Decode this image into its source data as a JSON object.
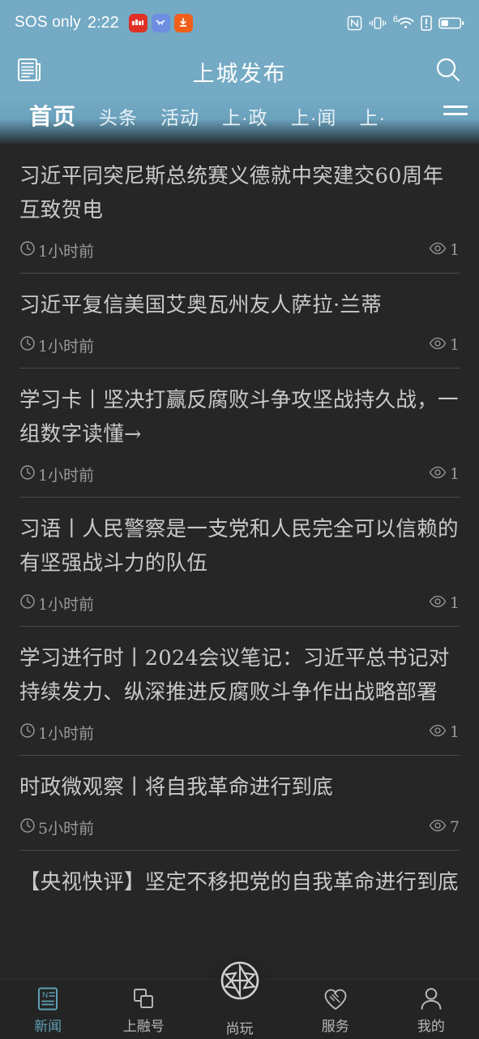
{
  "statusbar": {
    "carrier": "SOS only",
    "time": "2:22",
    "app_icons": [
      {
        "name": "red-app-icon",
        "color": "#e03127"
      },
      {
        "name": "blue-app-icon",
        "color": "#6d8ee0"
      },
      {
        "name": "download-icon",
        "color": "#f1601a"
      }
    ],
    "right_icons": [
      "nfc-icon",
      "vibrate-icon",
      "wifi-6-icon",
      "sim-alert-icon",
      "battery-icon"
    ],
    "wifi_generation": "6",
    "background_color": "#74aac4"
  },
  "header": {
    "title": "上城发布",
    "left_icon": "newspaper-icon",
    "right_icon": "search-icon",
    "background_color": "#74aac4"
  },
  "tabs": {
    "items": [
      {
        "label": "首页",
        "active": true
      },
      {
        "label": "头条",
        "active": false
      },
      {
        "label": "活动",
        "active": false
      },
      {
        "label": "上·政",
        "active": false
      },
      {
        "label": "上·闻",
        "active": false
      },
      {
        "label": "上·",
        "active": false
      }
    ],
    "menu_icon": "hamburger-menu-icon"
  },
  "articles": [
    {
      "title": "习近平同突尼斯总统赛义德就中突建交60周年互致贺电",
      "time": "1小时前",
      "views": "1"
    },
    {
      "title": "习近平复信美国艾奥瓦州友人萨拉·兰蒂",
      "time": "1小时前",
      "views": "1"
    },
    {
      "title": "学习卡丨坚决打赢反腐败斗争攻坚战持久战，一组数字读懂→",
      "time": "1小时前",
      "views": "1"
    },
    {
      "title": "习语丨人民警察是一支党和人民完全可以信赖的有坚强战斗力的队伍",
      "time": "1小时前",
      "views": "1"
    },
    {
      "title": "学习进行时丨2024会议笔记：习近平总书记对持续发力、纵深推进反腐败斗争作出战略部署",
      "time": "1小时前",
      "views": "1"
    },
    {
      "title": "时政微观察丨将自我革命进行到底",
      "time": "5小时前",
      "views": "7"
    },
    {
      "title": "【央视快评】坚定不移把党的自我革命进行到底",
      "time": "",
      "views": ""
    }
  ],
  "bottom_nav": {
    "items": [
      {
        "label": "新闻",
        "icon": "news-document-icon",
        "active": true
      },
      {
        "label": "上融号",
        "icon": "layers-copy-icon",
        "active": false
      },
      {
        "label": "尚玩",
        "icon": "camera-aperture-icon",
        "active": false
      },
      {
        "label": "服务",
        "icon": "heart-handshake-icon",
        "active": false
      },
      {
        "label": "我的",
        "icon": "user-profile-icon",
        "active": false
      }
    ],
    "active_color": "#5e9fb5",
    "inactive_color": "#b9b9b9"
  }
}
